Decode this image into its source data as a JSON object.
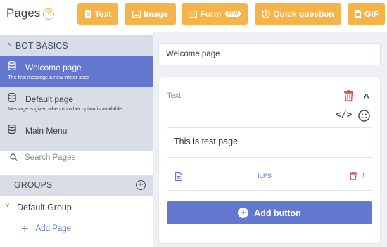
{
  "header": {
    "title": "Pages",
    "help_icon": "?",
    "buttons": [
      {
        "label": "Text",
        "icon": "text-file-icon"
      },
      {
        "label": "Image",
        "icon": "image-icon"
      },
      {
        "label": "Form",
        "icon": "form-icon",
        "badge": "PRO"
      },
      {
        "label": "Quick question",
        "icon": "question-circle-icon"
      },
      {
        "label": "GIF",
        "icon": "gif-file-icon"
      }
    ]
  },
  "sidebar": {
    "section_title": "BOT BASICS",
    "pages": [
      {
        "name": "Welcome page",
        "description": "The first message a new visitor sees",
        "active": true
      },
      {
        "name": "Default page",
        "description": "Message is given when no other option is available",
        "active": false
      },
      {
        "name": "Main Menu",
        "description": "",
        "active": false
      }
    ],
    "search_placeholder": "Search Pages",
    "groups_label": "GROUPS",
    "default_group": "Default Group",
    "add_page_label": "Add Page"
  },
  "editor": {
    "page_title_value": "Welcome page",
    "block_label": "Text",
    "message_text": "This is test page",
    "buttons": [
      {
        "label": "ILFS"
      }
    ],
    "add_button_label": "Add button"
  },
  "colors": {
    "accent": "#6578cf",
    "toolbar_button": "#f5b44a",
    "delete": "#d9534f"
  }
}
